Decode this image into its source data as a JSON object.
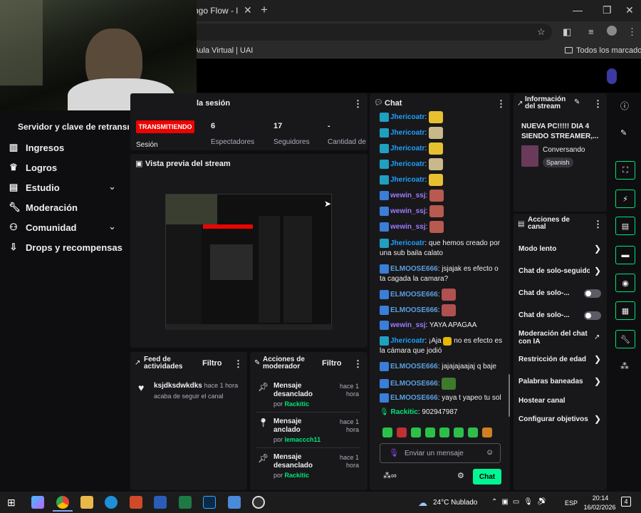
{
  "browser": {
    "tab_title": "ngo Flow - l",
    "new_tab": "+",
    "bookmark_1": "Aula Virtual | UAI",
    "all_bookmarks": "Todos los marcadores"
  },
  "sidebar": {
    "stream_key": "Servidor y clave de retransm",
    "items": [
      {
        "label": "Ingresos",
        "icon": "chart-bar-icon"
      },
      {
        "label": "Logros",
        "icon": "trophy-icon"
      },
      {
        "label": "Estudio",
        "icon": "film-icon"
      },
      {
        "label": "Moderación",
        "icon": "wrench-icon"
      },
      {
        "label": "Comunidad",
        "icon": "people-icon"
      },
      {
        "label": "Drops y recompensas",
        "icon": "drops-icon"
      }
    ]
  },
  "session": {
    "title": "la sesión",
    "live_badge": "TRANSMITIENDO",
    "session_label": "Sesión",
    "viewers": "6",
    "viewers_label": "Espectadores",
    "followers": "17",
    "followers_label": "Seguidores",
    "amount": "-",
    "amount_label": "Cantidad de"
  },
  "preview": {
    "title": "Vista previa del stream"
  },
  "feed": {
    "title_1": "Feed de",
    "title_2": "actividades",
    "filter": "Filtro",
    "user": "ksjdksdwkdks",
    "time": "hace 1 hora",
    "action": "acaba de seguir el canal"
  },
  "modactions": {
    "title_1": "Acciones de",
    "title_2": "moderador",
    "filter": "Filtro",
    "items": [
      {
        "line1": "Mensaje",
        "line2": "desanclado",
        "time1": "hace 1",
        "time2": "hora",
        "by": "por",
        "user": "Rackitic"
      },
      {
        "line1": "Mensaje",
        "line2": "anclado",
        "time1": "hace 1",
        "time2": "hora",
        "by": "por",
        "user": "lemaccch11"
      },
      {
        "line1": "Mensaje",
        "line2": "desanclado",
        "time1": "hace 1",
        "time2": "hora",
        "by": "por",
        "user": "Rackitic"
      }
    ]
  },
  "chat": {
    "title": "Chat",
    "messages": [
      {
        "user": "Jhericoatr",
        "text": "",
        "cls": "u-j"
      },
      {
        "user": "Jhericoatr",
        "text": "",
        "cls": "u-j"
      },
      {
        "user": "Jhericoatr",
        "text": "",
        "cls": "u-j"
      },
      {
        "user": "Jhericoatr",
        "text": "",
        "cls": "u-j"
      },
      {
        "user": "Jhericoatr",
        "text": "",
        "cls": "u-j"
      },
      {
        "user": "wewin_ssj",
        "text": "",
        "cls": "u-w"
      },
      {
        "user": "wewin_ssj",
        "text": "",
        "cls": "u-w"
      },
      {
        "user": "wewin_ssj",
        "text": "",
        "cls": "u-w"
      }
    ],
    "m9_user": "Jhericoatr",
    "m9_text1": ": que hemos creado por",
    "m9_text2": "una sub baila calato",
    "m10_user": "ELMOOSE666",
    "m10_text1": ": jsjajak es efecto o",
    "m10_text2": "ta cagada la camara?",
    "m11_user": "ELMOOSE666",
    "m12_user": "ELMOOSE666",
    "m13_user": "wewin_ssj",
    "m13_text": ": YAYA APAGAA",
    "m14_user": "Jhericoatr",
    "m14_text1": ": ¡Aja",
    "m14_text1b": "no es efecto es",
    "m14_text2": "la cámara que jodió",
    "m15_user": "ELMOOSE666",
    "m15_text": ": jajajajaajaj q baje",
    "m16_user": "ELMOOSE666",
    "m17_user": "ELMOOSE666",
    "m17_text": ": yaya t yapeo tu sol",
    "m18_user": "Rackitic",
    "m18_text": ": 902947987",
    "placeholder": "Enviar un mensaje",
    "send": "Chat"
  },
  "streaminfo": {
    "title_1": "Información",
    "title_2": "del stream",
    "stream_title_1": "NUEVA PC!!!!! DIA 4",
    "stream_title_2": "SIENDO STREAMER,...",
    "category": "Conversando",
    "language": "Spanish"
  },
  "channel_actions": {
    "title_1": "Acciones de",
    "title_2": "canal",
    "items": [
      {
        "label": "Modo lento",
        "type": "arrow"
      },
      {
        "label": "Chat de solo-seguido",
        "type": "arrow"
      },
      {
        "label": "Chat de solo-...",
        "type": "toggle"
      },
      {
        "label": "Chat de solo-...",
        "type": "toggle"
      },
      {
        "label": "Moderación del chat",
        "label2": "con IA",
        "type": "external"
      },
      {
        "label": "Restricción de edad",
        "type": "arrow"
      },
      {
        "label": "Palabras baneadas",
        "type": "arrow"
      },
      {
        "label": "Hostear canal",
        "type": "none"
      },
      {
        "label": "Configurar objetivos",
        "type": "arrow"
      }
    ]
  },
  "taskbar": {
    "weather": "24°C  Nublado",
    "lang": "ESP",
    "time": "20:14",
    "date": "16/02/2026",
    "notif": "4"
  },
  "colors": {
    "live": "#eb0400",
    "accent_green": "#00f593",
    "panel": "#18181b"
  }
}
